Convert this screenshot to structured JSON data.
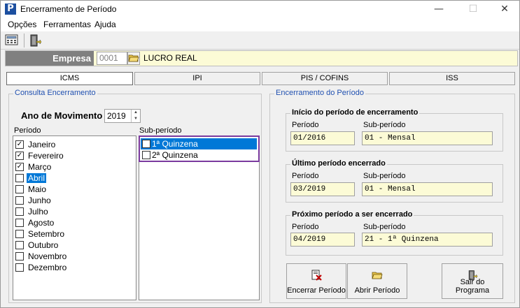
{
  "window": {
    "title": "Encerramento de Período",
    "icon_letter": "P",
    "minimize": "—",
    "maximize": "☐",
    "close": "✕"
  },
  "menu": [
    "Opções",
    "Ferramentas",
    "Ajuda"
  ],
  "empresa": {
    "label": "Empresa",
    "code": "0001",
    "name": "LUCRO REAL"
  },
  "tabs": [
    "ICMS",
    "IPI",
    "PIS / COFINS",
    "ISS"
  ],
  "consulta": {
    "title": "Consulta Encerramento",
    "ano_label": "Ano de Movimento",
    "ano_value": "2019",
    "periodo_label": "Período",
    "subperiodo_label": "Sub-período",
    "months": [
      {
        "label": "Janeiro",
        "checked": "✓"
      },
      {
        "label": "Fevereiro",
        "checked": "✓"
      },
      {
        "label": "Março",
        "checked": "✓"
      },
      {
        "label": "Abril",
        "checked": ""
      },
      {
        "label": "Maio",
        "checked": ""
      },
      {
        "label": "Junho",
        "checked": ""
      },
      {
        "label": "Julho",
        "checked": ""
      },
      {
        "label": "Agosto",
        "checked": ""
      },
      {
        "label": "Setembro",
        "checked": ""
      },
      {
        "label": "Outubro",
        "checked": ""
      },
      {
        "label": "Novembro",
        "checked": ""
      },
      {
        "label": "Dezembro",
        "checked": ""
      }
    ],
    "subperiods": [
      "1ª Quinzena",
      "2ª Quinzena"
    ]
  },
  "encerramento": {
    "title": "Encerramento do Período",
    "inicio": {
      "title": "Início do período de encerramento",
      "periodo_label": "Período",
      "sub_label": "Sub-período",
      "periodo": "01/2016",
      "sub": "01 - Mensal"
    },
    "ultimo": {
      "title": "Último período encerrado",
      "periodo_label": "Período",
      "sub_label": "Sub-período",
      "periodo": "03/2019",
      "sub": "01 - Mensal"
    },
    "proximo": {
      "title": "Próximo período a ser encerrado",
      "periodo_label": "Período",
      "sub_label": "Sub-período",
      "periodo": "04/2019",
      "sub": "21 - 1ª Quinzena"
    }
  },
  "buttons": {
    "encerrar": "Encerrar Período",
    "abrir": "Abrir Período",
    "sair": "Sair do Programa"
  },
  "colors": {
    "selection": "#0078d7",
    "readonly_bg": "#fcfbd6",
    "group_title": "#2050b0",
    "highlight_border": "#7a3a9e"
  }
}
